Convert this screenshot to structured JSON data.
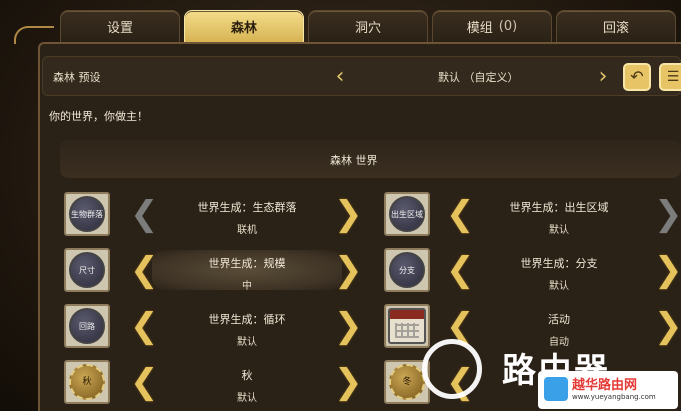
{
  "tabs": [
    {
      "label": "设置",
      "active": false
    },
    {
      "label": "森林",
      "active": true
    },
    {
      "label": "洞穴",
      "active": false
    },
    {
      "label": "模组",
      "count": "(0)",
      "active": false
    },
    {
      "label": "回滚",
      "active": false
    }
  ],
  "preset": {
    "label": "森林 预设",
    "value": "默认 （自定义）"
  },
  "subtitle": "你的世界，你做主！",
  "section_title": "森林 世界",
  "settings_left": [
    {
      "icon_text": "生物群落",
      "label": "世界生成：生态群落",
      "value": "联机"
    },
    {
      "icon_text": "尺寸",
      "label": "世界生成：规模",
      "value": "中"
    },
    {
      "icon_text": "回路",
      "label": "世界生成：循环",
      "value": "默认"
    },
    {
      "icon_text": "秋",
      "label": "秋",
      "value": "默认"
    }
  ],
  "settings_right": [
    {
      "icon_text": "出生区域",
      "label": "世界生成：出生区域",
      "value": "默认"
    },
    {
      "icon_text": "分支",
      "label": "世界生成：分支",
      "value": "默认"
    },
    {
      "icon_text": "",
      "label": "活动",
      "value": "自动"
    },
    {
      "icon_text": "冬",
      "label": "",
      "value": ""
    }
  ],
  "watermark": {
    "text": "路由器",
    "badge_main": "越华路由网",
    "badge_sub": "www.yueyangbang.com"
  },
  "colors": {
    "accent_gold": "#e6c25d",
    "tab_active": "#f4dc8a",
    "panel": "#2b2217"
  }
}
